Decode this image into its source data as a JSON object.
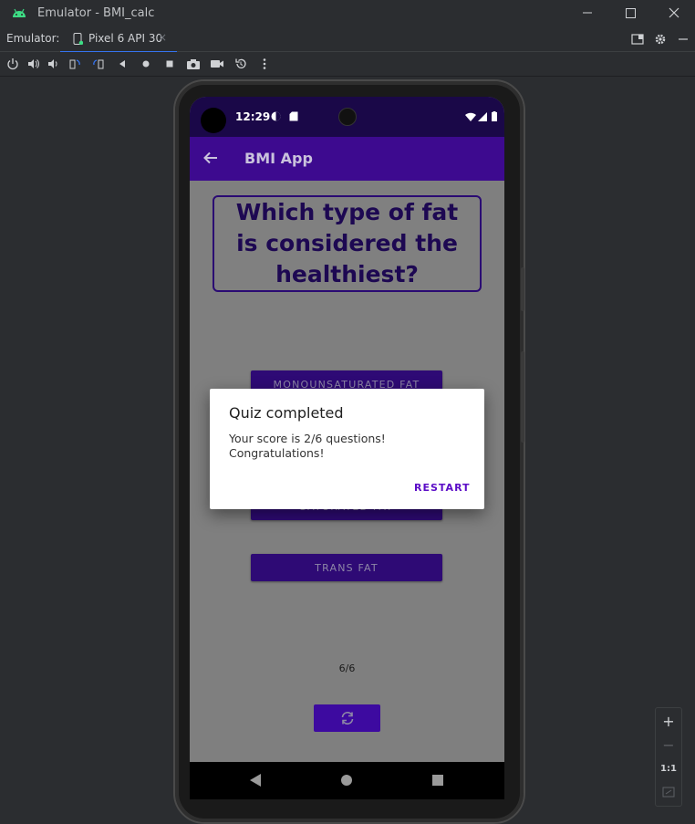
{
  "window": {
    "title": "Emulator - BMI_calc"
  },
  "tabs": {
    "label": "Emulator:",
    "device_tab": "Pixel 6 API 30",
    "close_glyph": "×"
  },
  "status_bar": {
    "time": "12:29"
  },
  "app_bar": {
    "title": "BMI App"
  },
  "quiz": {
    "question": "Which type of fat is considered the healthiest?",
    "answers": [
      "MONOUNSATURATED FAT",
      "SATURATED FAT",
      "TRANS FAT"
    ],
    "progress": "6/6"
  },
  "dialog": {
    "title": "Quiz completed",
    "message_line1": "Your score is 2/6 questions!",
    "message_line2": "Congratulations!",
    "button": "RESTART"
  },
  "zoom_panel": {
    "plus": "+",
    "minus": "−",
    "one_to_one": "1:1"
  },
  "colors": {
    "app_primary": "#3d0a8f",
    "status_bar": "#1a0848",
    "accent": "#5b0cc7",
    "tab_underline": "#3574f0",
    "android_green": "#3ddc84"
  }
}
